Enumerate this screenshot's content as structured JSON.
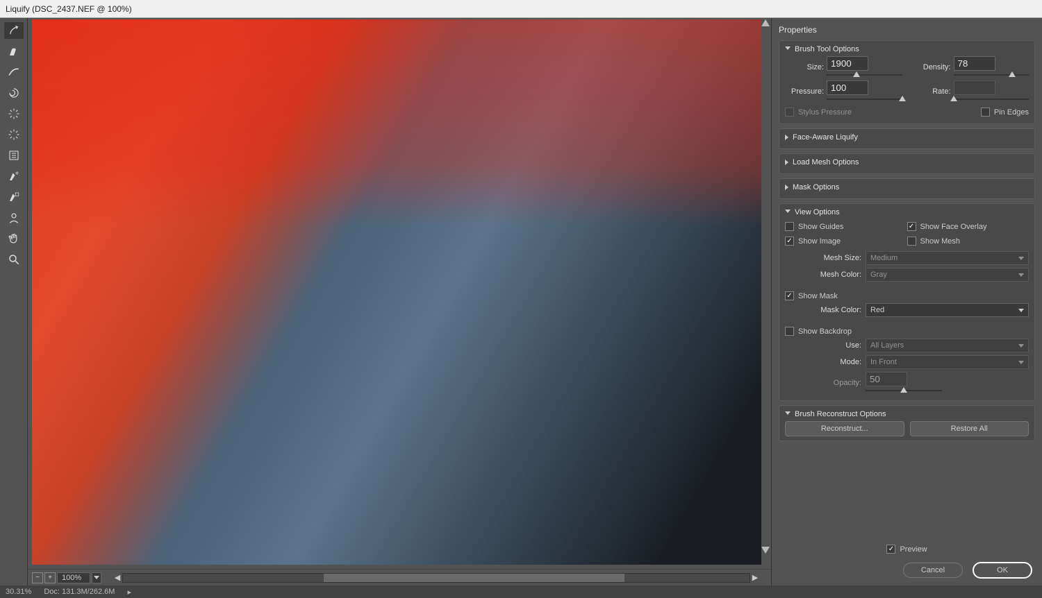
{
  "title": "Liquify (DSC_2437.NEF @ 100%)",
  "zoom": {
    "value": "100%",
    "minus_icon": "−",
    "plus_icon": "+"
  },
  "properties_title": "Properties",
  "sections": {
    "brush_tool": {
      "title": "Brush Tool Options",
      "size": {
        "label": "Size:",
        "value": "1900",
        "pct": 40
      },
      "density": {
        "label": "Density:",
        "value": "78",
        "pct": 78
      },
      "pressure": {
        "label": "Pressure:",
        "value": "100",
        "pct": 100
      },
      "rate": {
        "label": "Rate:",
        "value": "",
        "pct": 0
      },
      "stylus_pressure": "Stylus Pressure",
      "pin_edges": "Pin Edges"
    },
    "face_aware": "Face-Aware Liquify",
    "load_mesh": "Load Mesh Options",
    "mask_options": "Mask Options",
    "view_options": {
      "title": "View Options",
      "show_guides": "Show Guides",
      "show_face_overlay": "Show Face Overlay",
      "show_image": "Show Image",
      "show_mesh": "Show Mesh",
      "mesh_size": {
        "label": "Mesh Size:",
        "value": "Medium"
      },
      "mesh_color": {
        "label": "Mesh Color:",
        "value": "Gray"
      },
      "show_mask": "Show Mask",
      "mask_color": {
        "label": "Mask Color:",
        "value": "Red"
      },
      "show_backdrop": "Show Backdrop",
      "use": {
        "label": "Use:",
        "value": "All Layers"
      },
      "mode": {
        "label": "Mode:",
        "value": "In Front"
      },
      "opacity": {
        "label": "Opacity:",
        "value": "50",
        "pct": 50
      }
    },
    "reconstruct": {
      "title": "Brush Reconstruct Options",
      "btn1": "Reconstruct...",
      "btn2": "Restore All"
    }
  },
  "footer": {
    "preview": "Preview",
    "cancel": "Cancel",
    "ok": "OK"
  },
  "status": {
    "zoom": "30.31%",
    "doc": "Doc: 131.3M/262.6M"
  }
}
